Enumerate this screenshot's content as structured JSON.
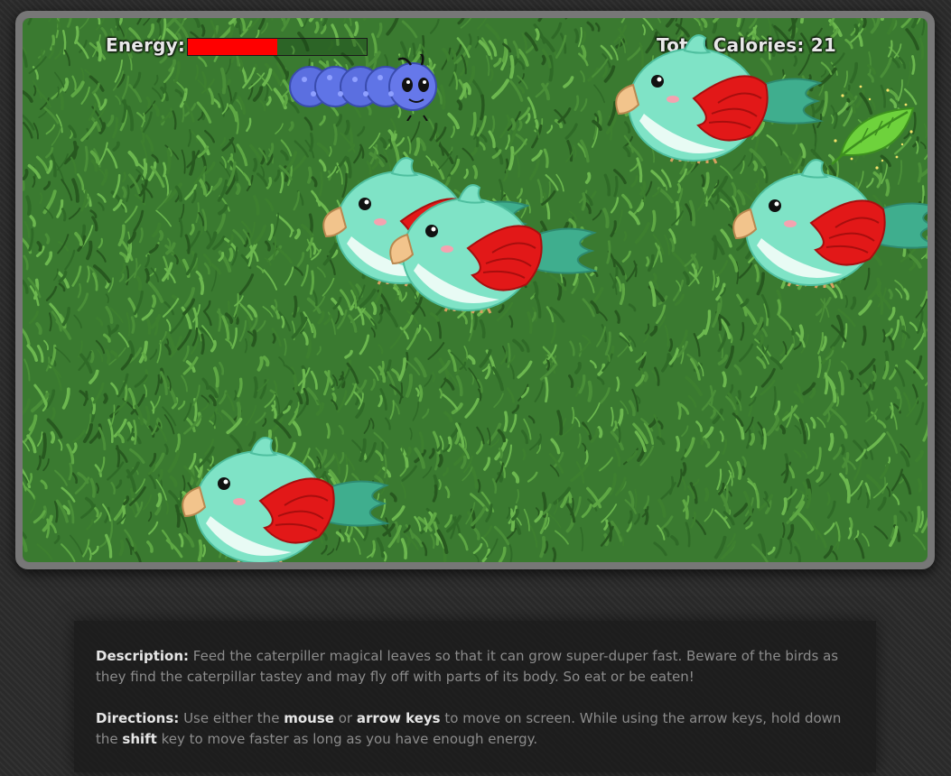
{
  "hud": {
    "energy_label": "Energy:",
    "energy_level": 0.5,
    "calories_label": "Total Calories:",
    "calories_value": "21"
  },
  "colors": {
    "energy_fill": "#ff0000",
    "grass": "#3a7a30",
    "bird_body": "#7fe0c3",
    "bird_wing": "#e21818",
    "caterpillar": "#5b6fe0"
  },
  "sprites": {
    "player": "caterpillar-icon",
    "enemy": "bird-icon",
    "food": "magic-leaf-icon"
  },
  "info": {
    "description_label": "Description:",
    "description_text": "Feed the caterpiller magical leaves so that it can grow super-duper fast. Beware of the birds as they find the caterpillar tastey and may fly off with parts of its body. So eat or be eaten!",
    "directions_label": "Directions:",
    "directions_t1": "Use either the",
    "directions_mouse": "mouse",
    "directions_t2": "or",
    "directions_arrows": "arrow keys",
    "directions_t3": "to move on screen. While using the arrow keys, hold down the",
    "directions_shift": "shift",
    "directions_t4": "key to move faster as long as you have enough energy."
  }
}
